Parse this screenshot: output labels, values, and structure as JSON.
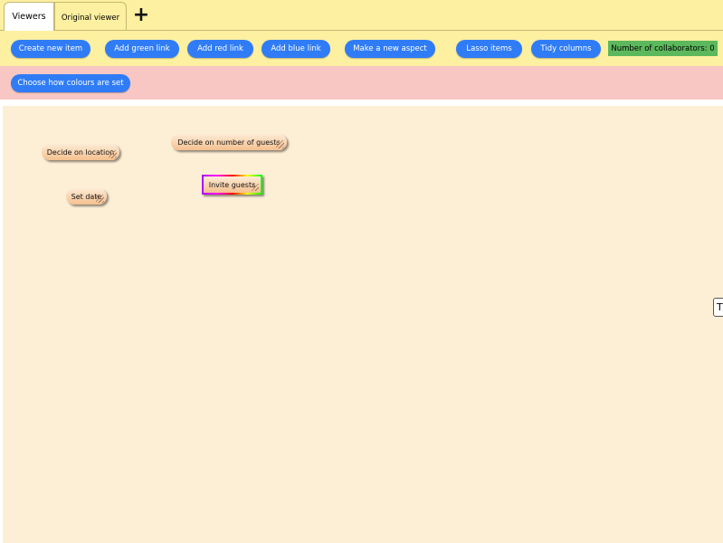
{
  "tabs": {
    "viewers_label": "Viewers",
    "original_label": "Original viewer",
    "add_tab_glyph": "+"
  },
  "toolbar": {
    "create_item": "Create new item",
    "add_green_link": "Add green link",
    "add_red_link": "Add red link",
    "add_blue_link": "Add blue link",
    "make_aspect": "Make a new aspect",
    "lasso": "Lasso items",
    "tidy": "Tidy columns",
    "collaborators": "Number of collaborators: 0"
  },
  "colour_bar": {
    "choose_colours": "Choose how colours are set"
  },
  "nodes": {
    "location": "Decide on location",
    "guests_number": "Decide on number of guests",
    "set_date": "Set date",
    "invite": "Invite guests"
  },
  "edge_handle": "T",
  "colors": {
    "toolbar_bg": "#fdf0a0",
    "button_blue": "#2f7cf6",
    "collab_green": "#5cb85c",
    "pink_band": "#f8c7c3",
    "canvas_bg": "#fdefd6",
    "node_fill": "#f5c08f"
  },
  "icons": {
    "add_tab": "plus-icon",
    "resize": "resize-grip-icon"
  }
}
